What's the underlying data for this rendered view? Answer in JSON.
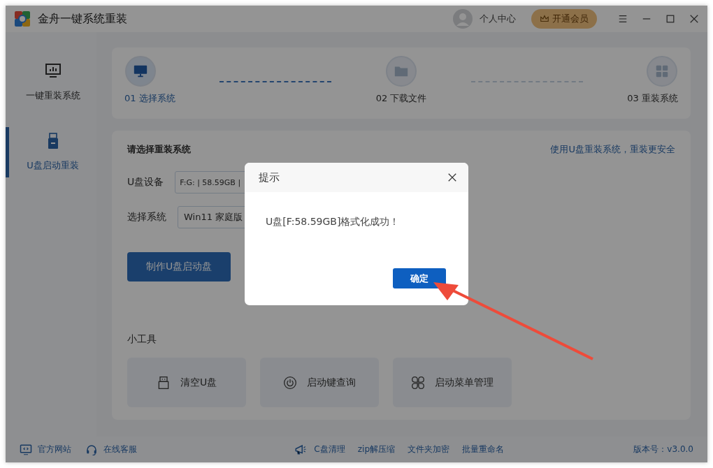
{
  "window": {
    "title": "金舟一键系统重装",
    "user_center": "个人中心",
    "vip_button": "开通会员"
  },
  "sidebar": {
    "items": [
      {
        "label": "一键重装系统",
        "kind": "monitor",
        "selected": false
      },
      {
        "label": "U盘启动重装",
        "kind": "usb",
        "selected": true
      }
    ]
  },
  "steps": [
    {
      "label": "01 选择系统",
      "kind": "monitor",
      "selected": true
    },
    {
      "label": "02 下载文件",
      "kind": "folder",
      "selected": false
    },
    {
      "label": "03 重装系统",
      "kind": "grid",
      "selected": false
    }
  ],
  "form": {
    "heading": "请选择重装系统",
    "link": "使用U盘重装系统，重装更安全",
    "fields": [
      {
        "label": "U盘设备",
        "value": "F:G: | 58.59GB |"
      },
      {
        "label": "选择系统",
        "value": "Win11 家庭版"
      }
    ],
    "button": "制作U盘启动盘"
  },
  "tools": {
    "heading": "小工具",
    "items": [
      {
        "label": "清空U盘",
        "kind": "usb"
      },
      {
        "label": "启动键查询",
        "kind": "power"
      },
      {
        "label": "启动菜单管理",
        "kind": "clover"
      }
    ]
  },
  "footer": {
    "left": [
      {
        "label": "官方网站",
        "kind": "monitor"
      },
      {
        "label": "在线客服",
        "kind": "headset"
      }
    ],
    "center": [
      "C盘清理",
      "zip解压缩",
      "文件夹加密",
      "批量重命名"
    ],
    "version": "版本号：v3.0.0"
  },
  "dialog": {
    "title": "提示",
    "message": "U盘[F:58.59GB]格式化成功！",
    "button": "确定"
  }
}
